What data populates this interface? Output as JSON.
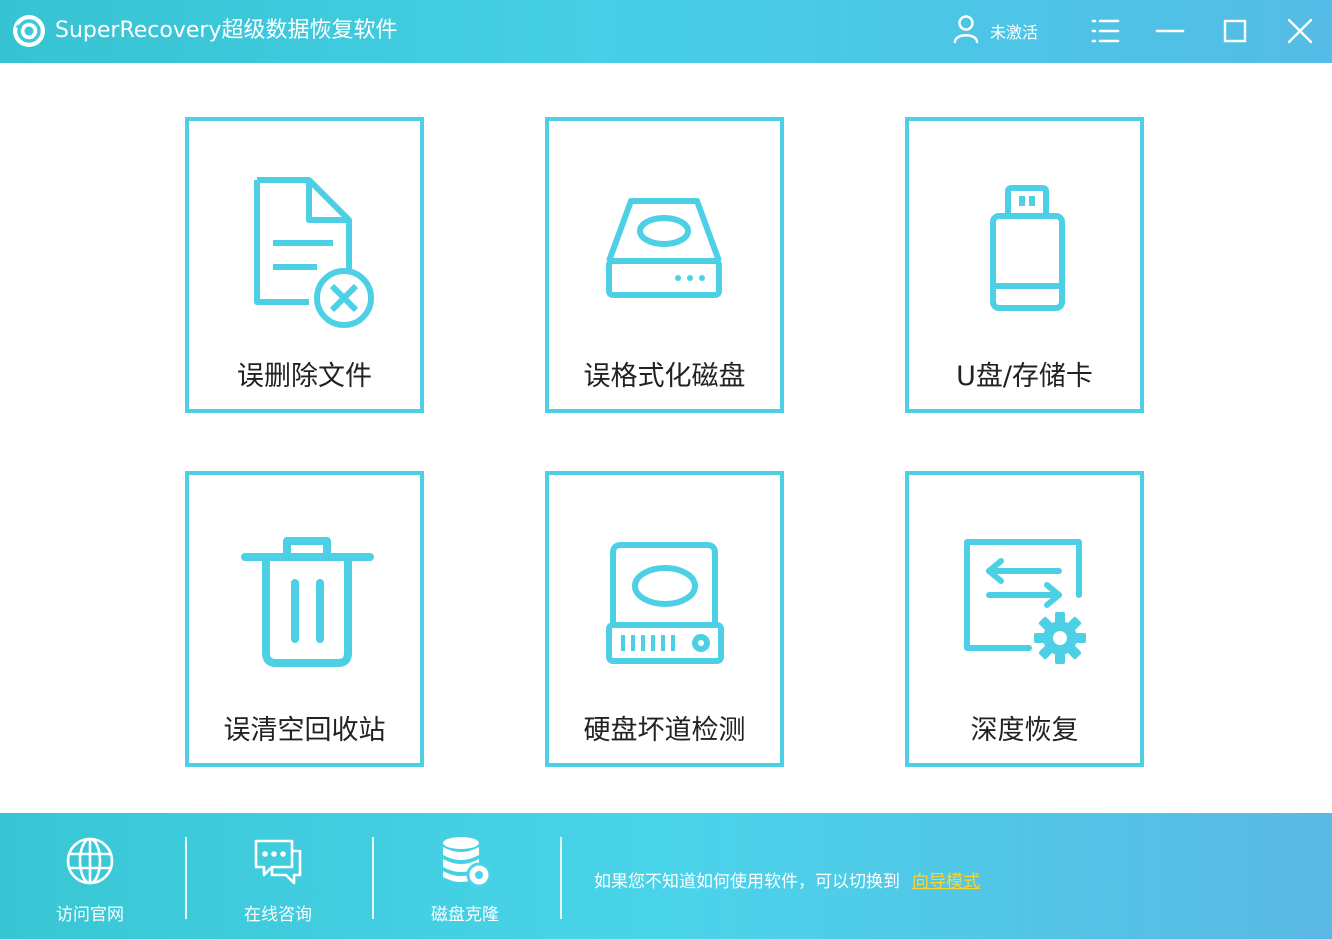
{
  "titlebar": {
    "title": "SuperRecovery超级数据恢复软件",
    "user_label": "未激活"
  },
  "tiles": [
    {
      "label": "误删除文件",
      "icon": "deleted-file-icon"
    },
    {
      "label": "误格式化磁盘",
      "icon": "hard-drive-icon"
    },
    {
      "label": "U盘/存储卡",
      "icon": "usb-drive-icon"
    },
    {
      "label": "误清空回收站",
      "icon": "trash-bin-icon"
    },
    {
      "label": "硬盘坏道检测",
      "icon": "disk-check-icon"
    },
    {
      "label": "深度恢复",
      "icon": "deep-recovery-icon"
    }
  ],
  "bottombar": {
    "items": [
      {
        "label": "访问官网",
        "icon": "globe-icon"
      },
      {
        "label": "在线咨询",
        "icon": "chat-icon"
      },
      {
        "label": "磁盘克隆",
        "icon": "database-clone-icon"
      }
    ],
    "hint": "如果您不知道如何使用软件，可以切换到",
    "guide_link": "向导模式"
  },
  "colors": {
    "accent": "#4dcfe6",
    "titlebar": "#46cfe6",
    "link": "#ffd42a"
  }
}
